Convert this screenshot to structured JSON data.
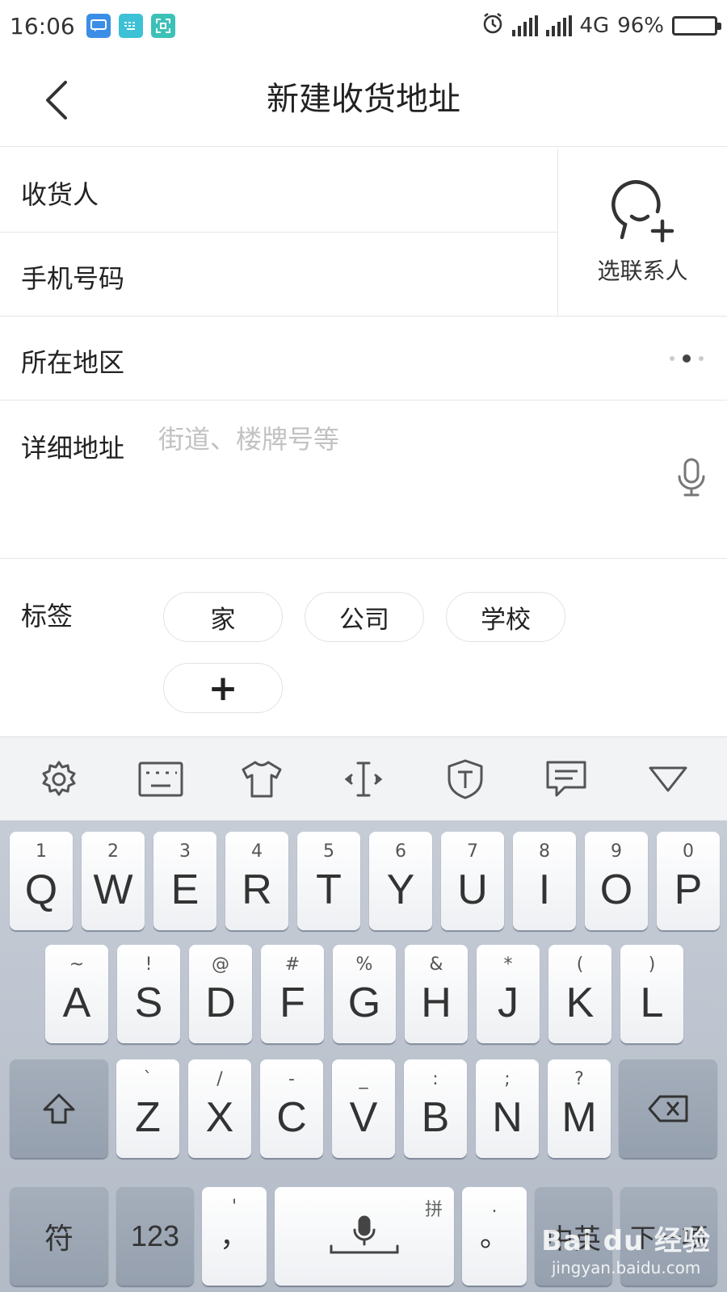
{
  "status_bar": {
    "time": "16:06",
    "network": "4G",
    "battery": "96%",
    "battery_level": 0.96,
    "icons": [
      "message-icon",
      "keyboard-icon",
      "scan-icon",
      "alarm-icon",
      "signal-icon",
      "signal-4g-icon",
      "battery-icon"
    ]
  },
  "nav": {
    "title": "新建收货地址",
    "back_icon": "chevron-left-icon"
  },
  "form": {
    "consignee_label": "收货人",
    "consignee_value": "",
    "phone_label": "手机号码",
    "phone_value": "",
    "region_label": "所在地区",
    "detail_label": "详细地址",
    "detail_placeholder": "街道、楼牌号等",
    "pick_contact_label": "选联系人"
  },
  "tags": {
    "label": "标签",
    "items": [
      "家",
      "公司",
      "学校"
    ],
    "add_symbol": "+"
  },
  "keyboard": {
    "toolbar_icons": [
      "gear-icon",
      "keyboard-layout-icon",
      "shirt-icon",
      "cursor-move-icon",
      "shield-t-icon",
      "comment-icon",
      "collapse-icon"
    ],
    "row1": [
      {
        "main": "Q",
        "sub": "1"
      },
      {
        "main": "W",
        "sub": "2"
      },
      {
        "main": "E",
        "sub": "3"
      },
      {
        "main": "R",
        "sub": "4"
      },
      {
        "main": "T",
        "sub": "5"
      },
      {
        "main": "Y",
        "sub": "6"
      },
      {
        "main": "U",
        "sub": "7"
      },
      {
        "main": "I",
        "sub": "8"
      },
      {
        "main": "O",
        "sub": "9"
      },
      {
        "main": "P",
        "sub": "0"
      }
    ],
    "row2": [
      {
        "main": "A",
        "sub": "~"
      },
      {
        "main": "S",
        "sub": "!"
      },
      {
        "main": "D",
        "sub": "@"
      },
      {
        "main": "F",
        "sub": "#"
      },
      {
        "main": "G",
        "sub": "%"
      },
      {
        "main": "H",
        "sub": "&"
      },
      {
        "main": "J",
        "sub": "*"
      },
      {
        "main": "K",
        "sub": "("
      },
      {
        "main": "L",
        "sub": ")"
      }
    ],
    "row3": [
      {
        "main": "Z",
        "sub": "`"
      },
      {
        "main": "X",
        "sub": "/"
      },
      {
        "main": "C",
        "sub": "-"
      },
      {
        "main": "V",
        "sub": "_"
      },
      {
        "main": "B",
        "sub": ":"
      },
      {
        "main": "N",
        "sub": ";"
      },
      {
        "main": "M",
        "sub": "?"
      }
    ],
    "symbols_key": "符",
    "numbers_key": "123",
    "comma_main": "，",
    "comma_sub": "'",
    "space_hint": "拼",
    "period_main": "。",
    "period_sub": ".",
    "lang_key": "中英",
    "next_key": "下一项"
  },
  "watermark": {
    "logo": "Bai du 经验",
    "url": "jingyan.baidu.com"
  }
}
